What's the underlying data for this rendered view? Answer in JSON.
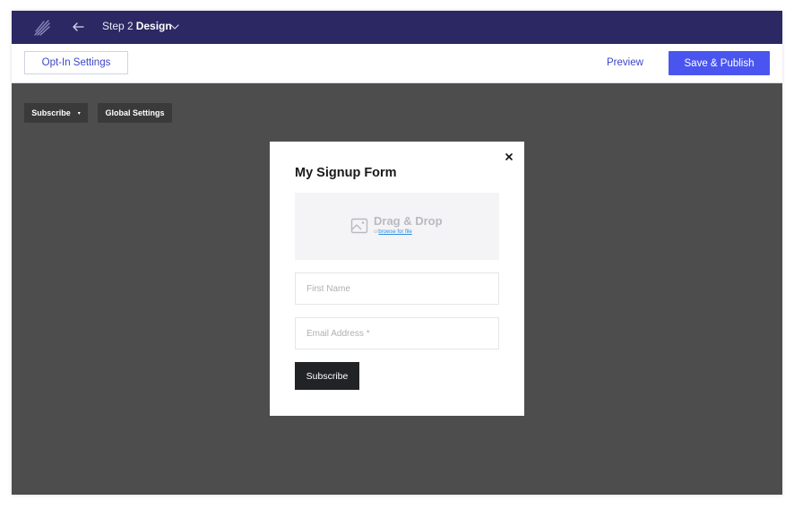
{
  "header": {
    "logo_icon": "quill-logo-icon",
    "back_icon": "arrow-left-icon",
    "step_prefix": "Step 2",
    "step_name": "Design",
    "dropdown_icon": "chevron-down-icon"
  },
  "toolbar": {
    "optin_label": "Opt-In Settings",
    "preview_label": "Preview",
    "publish_label": "Save & Publish"
  },
  "canvas_controls": {
    "subscribe_label": "Subscribe",
    "subscribe_caret": "▾",
    "global_label": "Global Settings"
  },
  "form": {
    "close_icon": "close-icon",
    "title": "My Signup Form",
    "dropzone": {
      "icon": "image-icon",
      "title": "Drag & Drop",
      "or_text": "or",
      "browse_link": "browse for file"
    },
    "first_name_placeholder": "First Name",
    "email_placeholder": "Email Address *",
    "submit_label": "Subscribe"
  },
  "colors": {
    "nav_bg": "#2b2863",
    "primary": "#4a55f0",
    "canvas_bg": "#4d4d4d",
    "submit_bg": "#222326",
    "link": "#2a8ee0"
  }
}
